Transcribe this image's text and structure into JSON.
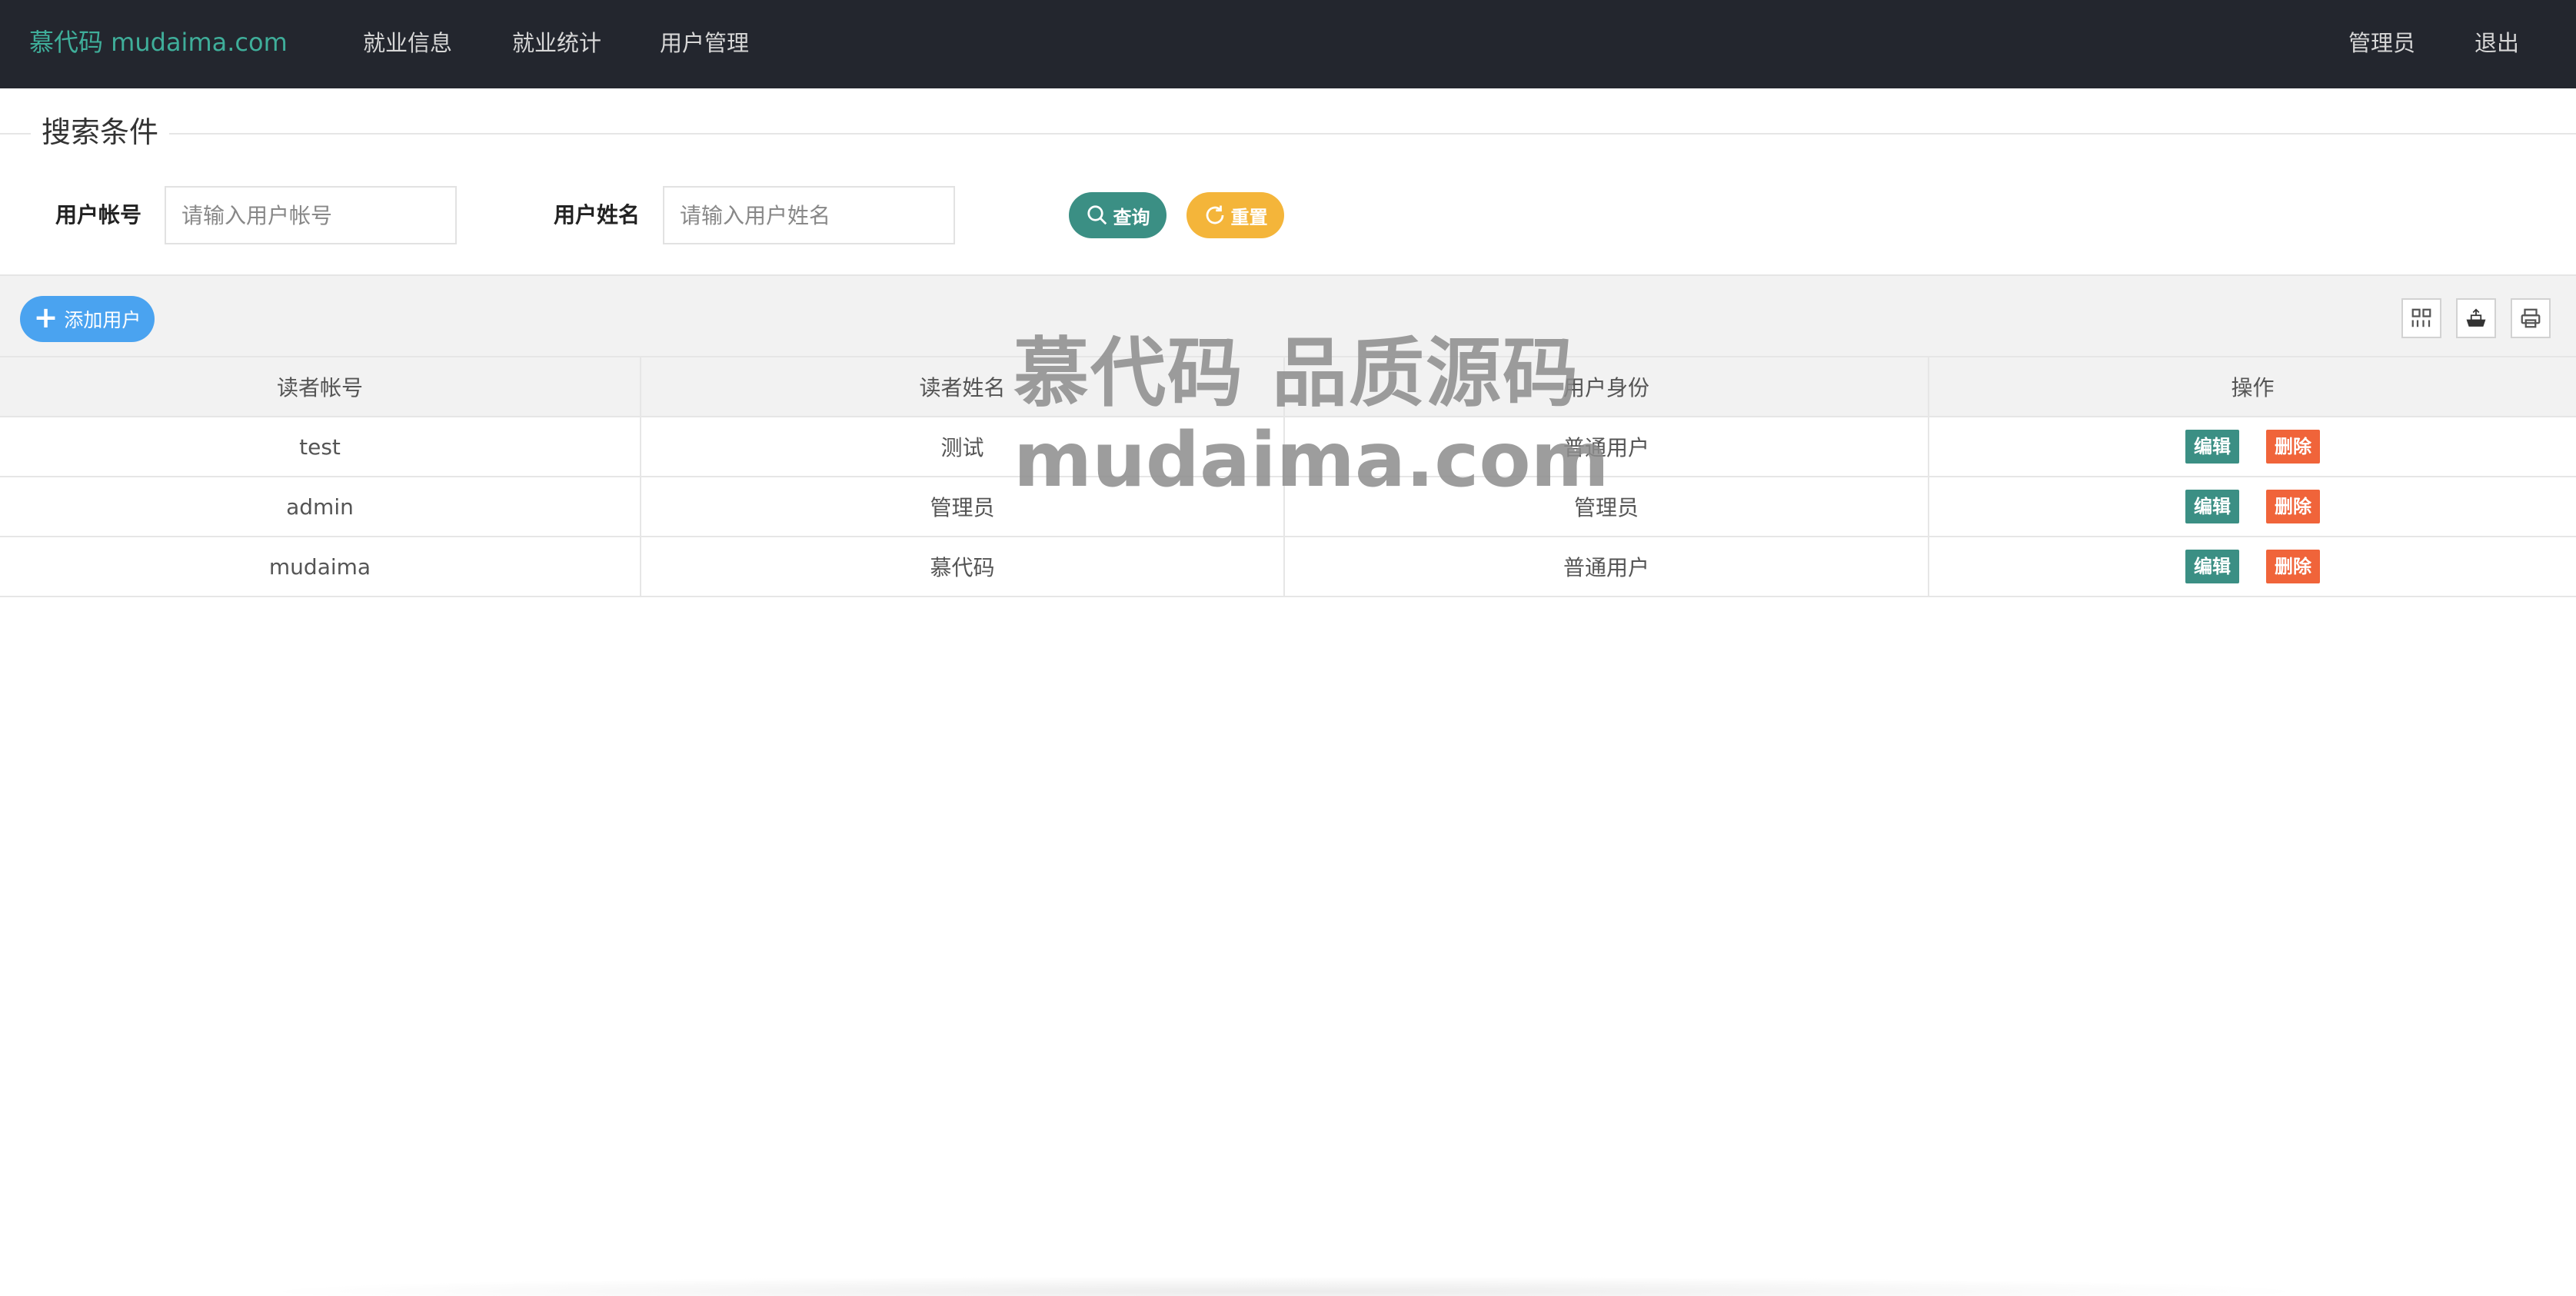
{
  "header": {
    "logo": "慕代码 mudaima.com",
    "nav": [
      "就业信息",
      "就业统计",
      "用户管理"
    ],
    "user": "管理员",
    "logout": "退出",
    "bg_color": "#23262e",
    "logo_color": "#3fae9a"
  },
  "search": {
    "legend": "搜索条件",
    "account_label": "用户帐号",
    "account_placeholder": "请输入用户帐号",
    "name_label": "用户姓名",
    "name_placeholder": "请输入用户姓名",
    "query_label": "查询",
    "reset_label": "重置"
  },
  "toolbar": {
    "add_label": "添加用户",
    "icons": [
      "columns-icon",
      "export-icon",
      "print-icon"
    ]
  },
  "table": {
    "columns": [
      "读者帐号",
      "读者姓名",
      "用户身份",
      "操作"
    ],
    "rows": [
      {
        "account": "test",
        "name": "测试",
        "role": "普通用户"
      },
      {
        "account": "admin",
        "name": "管理员",
        "role": "管理员"
      },
      {
        "account": "mudaima",
        "name": "慕代码",
        "role": "普通用户"
      }
    ],
    "edit_label": "编辑",
    "delete_label": "删除"
  },
  "watermark": {
    "line1": "慕代码 品质源码",
    "line2": "mudaima.com"
  },
  "colors": {
    "primary": "#3b8f84",
    "warning": "#f4b53a",
    "danger": "#f0643a",
    "info": "#4aa3f0"
  }
}
